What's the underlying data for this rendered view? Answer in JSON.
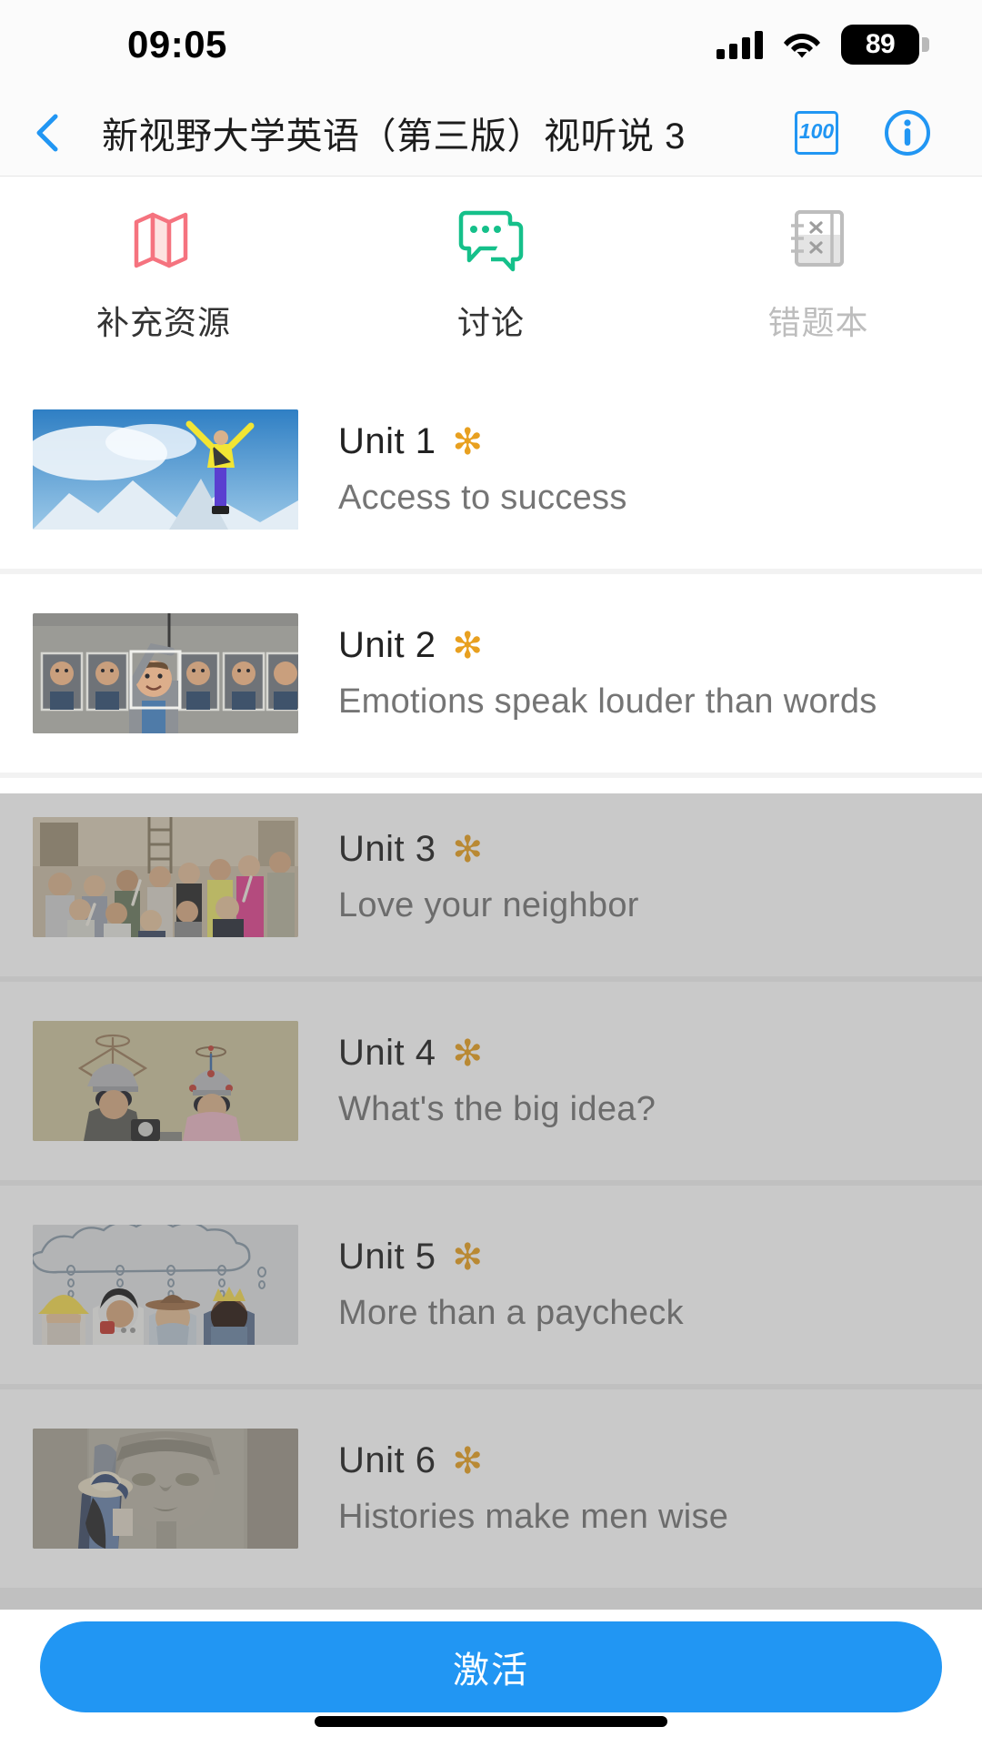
{
  "status_bar": {
    "time": "09:05",
    "battery_percent": "89",
    "signal_icon": "cellular-signal-icon",
    "wifi_icon": "wifi-icon",
    "battery_icon": "battery-icon"
  },
  "navbar": {
    "back_icon": "back-chevron-icon",
    "title": "新视野大学英语（第三版）视听说 3",
    "score_icon_label": "100",
    "score_icon": "score-100-icon",
    "info_icon": "info-circle-icon",
    "accent_color": "#2196f3"
  },
  "tabs": [
    {
      "label": "补充资源",
      "icon": "map-icon",
      "color": "#f5737f",
      "disabled": false
    },
    {
      "label": "讨论",
      "icon": "chat-icon",
      "color": "#15c08a",
      "disabled": false
    },
    {
      "label": "错题本",
      "icon": "notebook-x-icon",
      "color": "#bdbdbd",
      "disabled": true
    }
  ],
  "units": [
    {
      "title": "Unit 1",
      "badge": "✻",
      "subtitle": "Access to success",
      "thumb": "mountain-climber-photo"
    },
    {
      "title": "Unit 2",
      "badge": "✻",
      "subtitle": "Emotions speak louder than words",
      "thumb": "expressions-grid-photo"
    },
    {
      "title": "Unit 3",
      "badge": "✻",
      "subtitle": "Love your neighbor",
      "thumb": "volunteer-group-photo"
    },
    {
      "title": "Unit 4",
      "badge": "✻",
      "subtitle": "What's the big idea?",
      "thumb": "thinking-caps-photo"
    },
    {
      "title": "Unit 5",
      "badge": "✻",
      "subtitle": "More than a paycheck",
      "thumb": "kids-careers-photo"
    },
    {
      "title": "Unit 6",
      "badge": "✻",
      "subtitle": "Histories make men wise",
      "thumb": "egypt-statue-photo"
    }
  ],
  "bottom_bar": {
    "activate_label": "激活",
    "button_color": "#2196f3"
  },
  "colors": {
    "badge_star": "#e8a020",
    "list_background": "#f2f2f2",
    "overlay": "rgba(90,90,90,0.33)"
  }
}
